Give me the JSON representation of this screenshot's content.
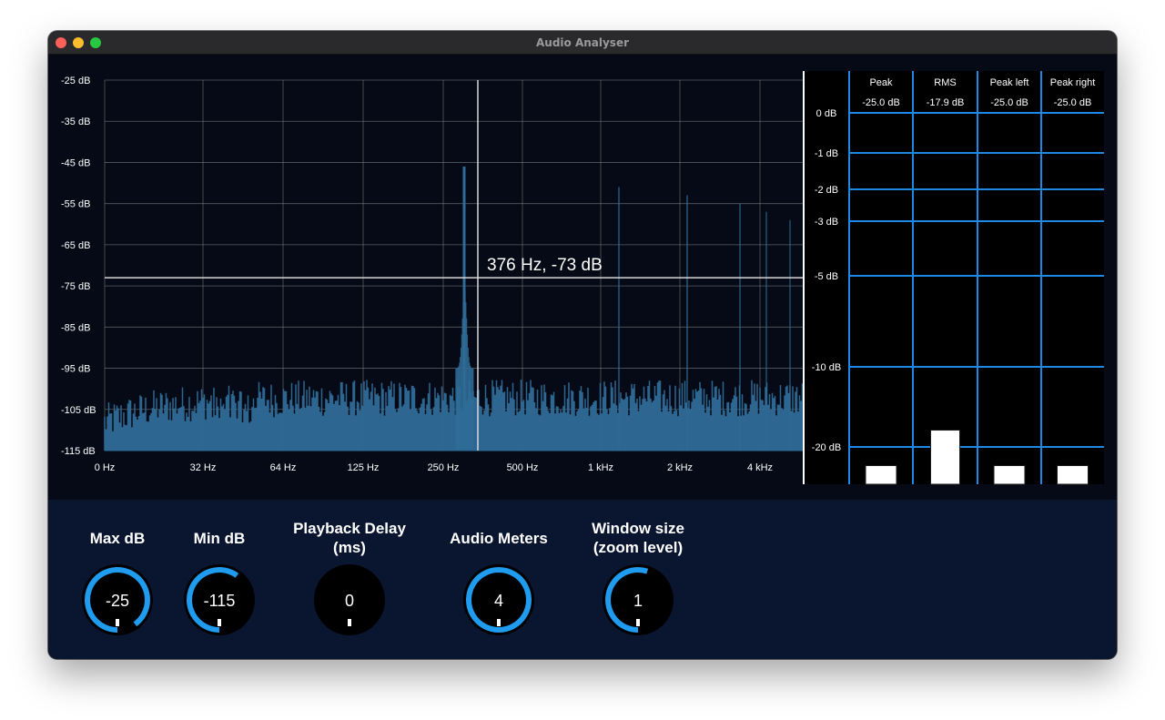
{
  "window": {
    "title": "Audio Analyser"
  },
  "spectrum": {
    "y_ticks": [
      "-25 dB",
      "-35 dB",
      "-45 dB",
      "-55 dB",
      "-65 dB",
      "-75 dB",
      "-85 dB",
      "-95 dB",
      "-105 dB",
      "-115 dB"
    ],
    "x_ticks": [
      "0 Hz",
      "32 Hz",
      "64 Hz",
      "125 Hz",
      "250 Hz",
      "500 Hz",
      "1 kHz",
      "2 kHz",
      "4 kHz"
    ],
    "cursor_readout": "376 Hz, -73 dB",
    "cursor_freq_hz": 376,
    "cursor_db": -73,
    "db_range": [
      -115,
      -25
    ],
    "bar_color": "#2f6c97",
    "grid_color": "#9a9a9a"
  },
  "meters": {
    "columns": [
      {
        "label": "Peak",
        "value": "-25.0 dB",
        "level_db": -25.0
      },
      {
        "label": "RMS",
        "value": "-17.9 dB",
        "level_db": -17.9
      },
      {
        "label": "Peak left",
        "value": "-25.0 dB",
        "level_db": -25.0
      },
      {
        "label": "Peak right",
        "value": "-25.0 dB",
        "level_db": -25.0
      }
    ],
    "scale_labels": [
      "0 dB",
      "-1 dB",
      "-2 dB",
      "-3 dB",
      "-5 dB",
      "-10 dB",
      "-20 dB"
    ],
    "line_color": "#1e88e5"
  },
  "controls": {
    "knobs": [
      {
        "label_lines": [
          "Max dB"
        ],
        "value": "-25",
        "fill_fraction": 0.9
      },
      {
        "label_lines": [
          "Min dB"
        ],
        "value": "-115",
        "fill_fraction": 0.6
      },
      {
        "label_lines": [
          "Playback Delay",
          "(ms)"
        ],
        "value": "0",
        "fill_fraction": 0.0
      },
      {
        "label_lines": [
          "Audio Meters"
        ],
        "value": "4",
        "fill_fraction": 1.0
      },
      {
        "label_lines": [
          "Window size",
          "(zoom level)"
        ],
        "value": "1",
        "fill_fraction": 0.55
      }
    ],
    "accent_color": "#1f9cf0"
  }
}
